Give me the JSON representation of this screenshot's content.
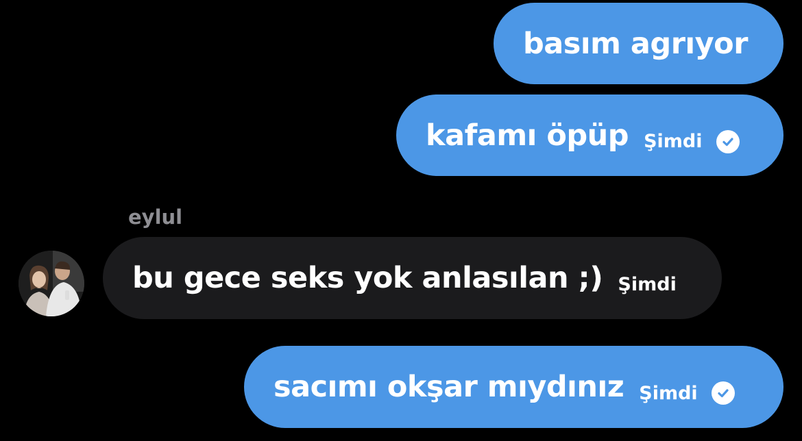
{
  "messages": [
    {
      "text": "basım agrıyor"
    },
    {
      "text": "kafamı öpüp",
      "time": "Şimdi"
    },
    {
      "sender": "eylul",
      "text": "bu gece seks yok anlasılan ;)",
      "time": "Şimdi"
    },
    {
      "text": "sacımı okşar mıydınız",
      "time": "Şimdi"
    }
  ],
  "colors": {
    "outgoing_bubble": "#4c97e6",
    "incoming_bubble": "#1b1b1d",
    "background": "#000000",
    "sender_name": "#8e8e93"
  },
  "icons": {
    "read_receipt": "check-circle-icon",
    "avatar": "avatar"
  }
}
